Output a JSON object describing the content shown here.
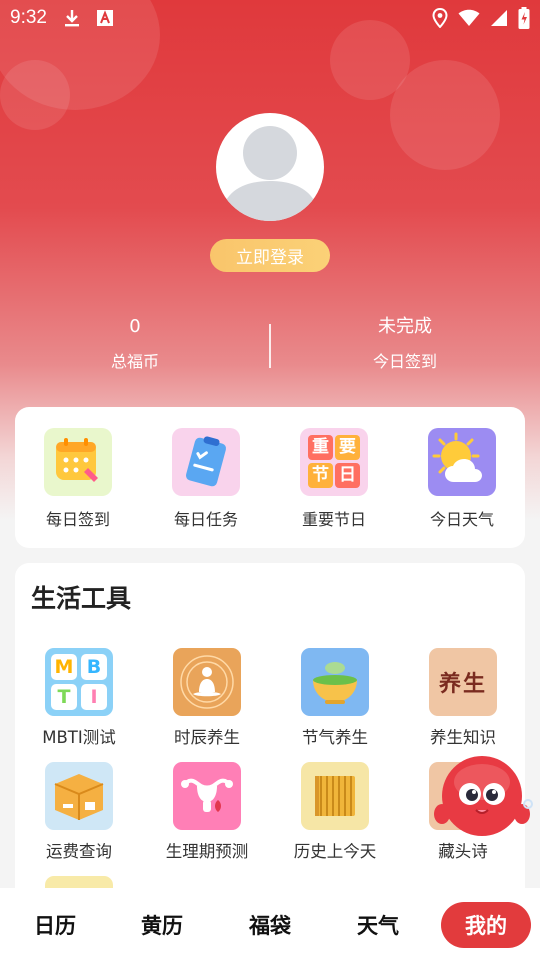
{
  "status_bar": {
    "time": "9:32",
    "icons": [
      "download-icon",
      "a-badge-icon",
      "location-icon",
      "wifi-icon",
      "signal-icon",
      "battery-charging-icon"
    ]
  },
  "profile": {
    "login_label": "立即登录",
    "stats": [
      {
        "value": "0",
        "label": "总福币"
      },
      {
        "value": "未完成",
        "label": "今日签到"
      }
    ]
  },
  "quick_actions": [
    {
      "label": "每日签到",
      "icon": "calendar-checkin-icon"
    },
    {
      "label": "每日任务",
      "icon": "task-clipboard-icon"
    },
    {
      "label": "重要节日",
      "icon": "festival-tiles-icon"
    },
    {
      "label": "今日天气",
      "icon": "sun-cloud-icon"
    }
  ],
  "tools": {
    "title": "生活工具",
    "items": [
      {
        "label": "MBTI测试",
        "icon": "mbti-icon",
        "tiles": [
          "M",
          "B",
          "T",
          "I"
        ]
      },
      {
        "label": "时辰养生",
        "icon": "meditation-icon"
      },
      {
        "label": "节气养生",
        "icon": "herbal-bowl-icon"
      },
      {
        "label": "养生知识",
        "icon": "calligraphy-icon",
        "text": "养生"
      },
      {
        "label": "运费查询",
        "icon": "parcel-box-icon"
      },
      {
        "label": "生理期预测",
        "icon": "uterus-icon"
      },
      {
        "label": "历史上今天",
        "icon": "bamboo-scroll-icon"
      },
      {
        "label": "藏头诗",
        "icon": "poem-icon"
      }
    ]
  },
  "quick_festival_tiles": [
    "重",
    "要",
    "节",
    "日"
  ],
  "bottom_nav": [
    {
      "label": "日历",
      "active": false
    },
    {
      "label": "黄历",
      "active": false
    },
    {
      "label": "福袋",
      "active": false
    },
    {
      "label": "天气",
      "active": false
    },
    {
      "label": "我的",
      "active": true
    }
  ],
  "colors": {
    "primary_red": "#e23b3d",
    "login_gold": "#f9c56b"
  }
}
